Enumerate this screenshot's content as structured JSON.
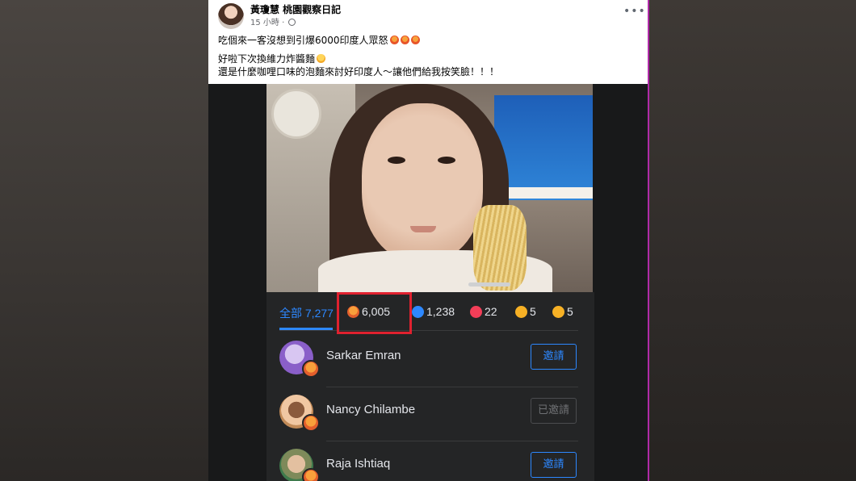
{
  "post": {
    "author": "黃瓊慧 桃園觀察日記",
    "time": "15 小時",
    "lines": [
      "吃個來一客沒想到引爆6000印度人眾怒",
      "好啦下次換維力炸醬麵",
      "還是什麼咖哩口味的泡麵來討好印度人～讓他們給我按笑臉！！！"
    ],
    "more_label": "•••"
  },
  "reactions": {
    "tabs": [
      {
        "label": "全部 7,277",
        "icon": "",
        "active": true
      },
      {
        "label": "6,005",
        "icon": "angry-react-icon",
        "active": false
      },
      {
        "label": "1,238",
        "icon": "like-react-icon",
        "active": false
      },
      {
        "label": "22",
        "icon": "love-react-icon",
        "active": false
      },
      {
        "label": "5",
        "icon": "care-react-icon",
        "active": false
      },
      {
        "label": "5",
        "icon": "haha-react-icon",
        "active": false
      }
    ],
    "users": [
      {
        "name": "Sarkar Emran",
        "button": "邀請",
        "invited": false
      },
      {
        "name": "Nancy Chilambe",
        "button": "已邀請",
        "invited": true
      },
      {
        "name": "Raja Ishtiaq",
        "button": "邀請",
        "invited": false
      }
    ]
  },
  "colors": {
    "accent": "#2d88ff",
    "highlight_box": "#e0212f",
    "sheet_bg": "#242526"
  }
}
